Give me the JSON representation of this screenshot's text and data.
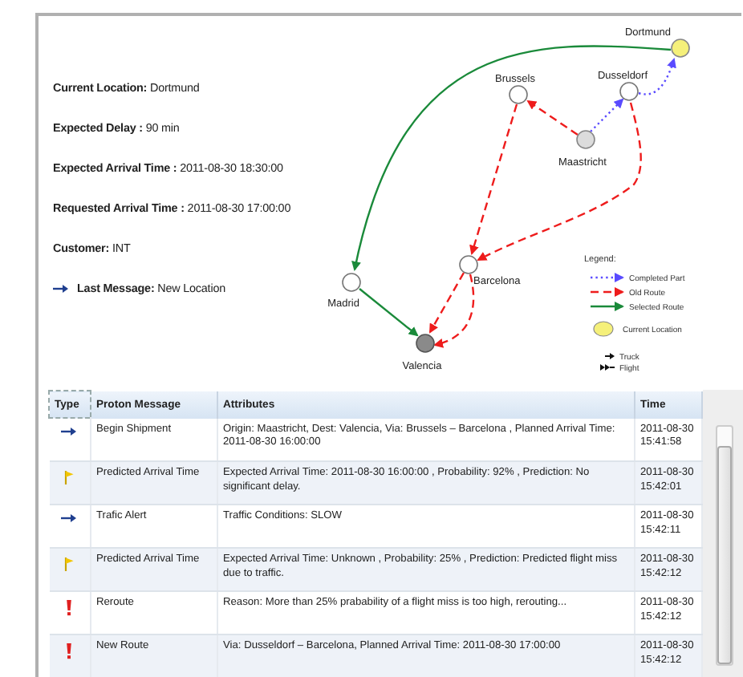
{
  "summary": {
    "fields": [
      {
        "label": "Current Location:",
        "value": "Dortmund"
      },
      {
        "label": "Expected Delay :",
        "value": "90 min"
      },
      {
        "label": "Expected Arrival Time :",
        "value": "2011-08-30 18:30:00"
      },
      {
        "label": "Requested Arrival Time :",
        "value": "2011-08-30 17:00:00"
      },
      {
        "label": "Customer:",
        "value": "INT"
      }
    ],
    "last_message": {
      "kind": "info",
      "label": "Last Message:",
      "value": "New Location"
    }
  },
  "map": {
    "locations": [
      {
        "name": "Dortmund",
        "kind": "current"
      },
      {
        "name": "Dusseldorf",
        "kind": "stop"
      },
      {
        "name": "Brussels",
        "kind": "stop"
      },
      {
        "name": "Maastricht",
        "kind": "origin"
      },
      {
        "name": "Barcelona",
        "kind": "stop"
      },
      {
        "name": "Madrid",
        "kind": "stop"
      },
      {
        "name": "Valencia",
        "kind": "destination"
      }
    ],
    "legend": {
      "title": "Legend:",
      "items": [
        {
          "kind": "completed",
          "label": "Completed Part"
        },
        {
          "kind": "old",
          "label": "Old Route"
        },
        {
          "kind": "selected",
          "label": "Selected Route"
        },
        {
          "kind": "current",
          "label": "Current Location"
        },
        {
          "kind": "truck",
          "label": "Truck"
        },
        {
          "kind": "flight",
          "label": "Flight"
        }
      ]
    }
  },
  "table": {
    "columns": [
      "Type",
      "Proton Message",
      "Attributes",
      "Time"
    ],
    "rows": [
      {
        "kind": "info",
        "message": "Begin Shipment",
        "attributes": "Origin: Maastricht, Dest: Valencia, Via: Brussels – Barcelona , Planned Arrival Time: 2011-08-30 16:00:00",
        "time": "2011-08-30 15:41:58"
      },
      {
        "kind": "prediction",
        "message": "Predicted Arrival Time",
        "attributes": "Expected Arrival Time: 2011-08-30 16:00:00 , Probability: 92% , Prediction: No significant delay.",
        "time": "2011-08-30 15:42:01"
      },
      {
        "kind": "info",
        "message": "Trafic Alert",
        "attributes": "Traffic Conditions: SLOW",
        "time": "2011-08-30 15:42:11"
      },
      {
        "kind": "prediction",
        "message": "Predicted Arrival Time",
        "attributes": "Expected Arrival Time: Unknown , Probability: 25% , Prediction: Predicted flight miss due to traffic.",
        "time": "2011-08-30 15:42:12"
      },
      {
        "kind": "alert",
        "message": "Reroute",
        "attributes": "Reason: More than 25% prabability of a flight miss is too high, rerouting...",
        "time": "2011-08-30 15:42:12"
      },
      {
        "kind": "alert",
        "message": "New Route",
        "attributes": "Via: Dusseldorf – Barcelona, Planned Arrival Time: 2011-08-30 17:00:00",
        "time": "2011-08-30 15:42:12"
      }
    ]
  }
}
